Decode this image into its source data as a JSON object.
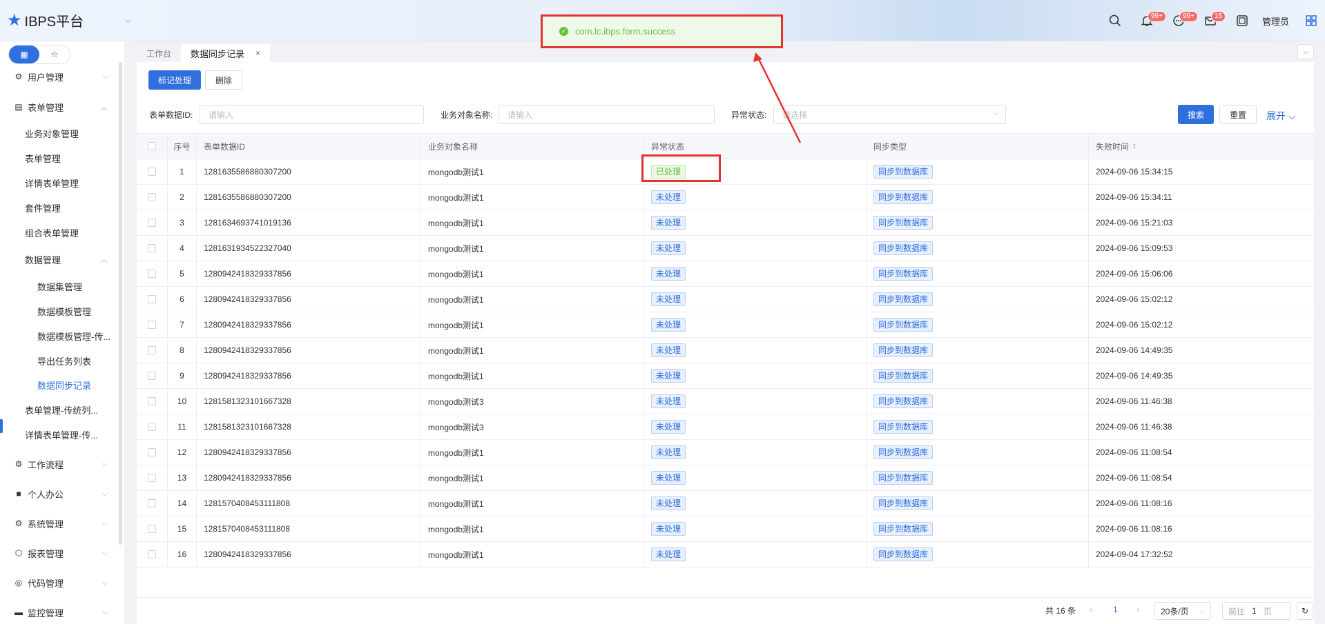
{
  "app": {
    "title": "IBPS平台",
    "user": "管理员"
  },
  "badges": {
    "bell": "99+",
    "message": "99+",
    "mail": "15"
  },
  "toast": {
    "message": "com.lc.ibps.form.success"
  },
  "sidebar": {
    "items": [
      {
        "label": "用户管理",
        "icon": "gear-icon",
        "level": 1
      },
      {
        "label": "表单管理",
        "icon": "form-icon",
        "level": 1
      },
      {
        "label": "业务对象管理",
        "level": 2
      },
      {
        "label": "表单管理",
        "level": 2
      },
      {
        "label": "详情表单管理",
        "level": 2
      },
      {
        "label": "套件管理",
        "level": 2
      },
      {
        "label": "组合表单管理",
        "level": 2
      },
      {
        "label": "数据管理",
        "level": 2
      },
      {
        "label": "数据集管理",
        "level": 3
      },
      {
        "label": "数据模板管理",
        "level": 3
      },
      {
        "label": "数据模板管理-传...",
        "level": 3
      },
      {
        "label": "导出任务列表",
        "level": 3
      },
      {
        "label": "数据同步记录",
        "level": 3,
        "active": true
      },
      {
        "label": "表单管理-传统列...",
        "level": 2
      },
      {
        "label": "详情表单管理-传...",
        "level": 2
      },
      {
        "label": "工作流程",
        "icon": "workflow-icon",
        "level": 1
      },
      {
        "label": "个人办公",
        "icon": "briefcase-icon",
        "level": 1
      },
      {
        "label": "系统管理",
        "icon": "gear-icon",
        "level": 1
      },
      {
        "label": "报表管理",
        "icon": "cube-icon",
        "level": 1
      },
      {
        "label": "代码管理",
        "icon": "code-icon",
        "level": 1
      },
      {
        "label": "监控管理",
        "icon": "monitor-icon",
        "level": 1
      }
    ]
  },
  "tabs": [
    {
      "label": "工作台"
    },
    {
      "label": "数据同步记录",
      "active": true
    }
  ],
  "toolbar": {
    "mark_label": "标记处理",
    "delete_label": "删除"
  },
  "filters": {
    "form_id_label": "表单数据ID:",
    "form_id_placeholder": "请输入",
    "biz_name_label": "业务对象名称:",
    "biz_name_placeholder": "请输入",
    "status_label": "异常状态:",
    "status_placeholder": "请选择",
    "search_label": "搜索",
    "reset_label": "重置",
    "expand_label": "展开"
  },
  "table": {
    "headers": [
      "序号",
      "表单数据ID",
      "业务对象名称",
      "异常状态",
      "同步类型",
      "失败时间"
    ],
    "rows": [
      {
        "no": "1",
        "id": "1281635586880307200",
        "name": "mongodb测试1",
        "status": "已处理",
        "type": "同步到数据库",
        "time": "2024-09-06 15:34:15"
      },
      {
        "no": "2",
        "id": "1281635586880307200",
        "name": "mongodb测试1",
        "status": "未处理",
        "type": "同步到数据库",
        "time": "2024-09-06 15:34:11"
      },
      {
        "no": "3",
        "id": "1281634693741019136",
        "name": "mongodb测试1",
        "status": "未处理",
        "type": "同步到数据库",
        "time": "2024-09-06 15:21:03"
      },
      {
        "no": "4",
        "id": "1281631934522327040",
        "name": "mongodb测试1",
        "status": "未处理",
        "type": "同步到数据库",
        "time": "2024-09-06 15:09:53"
      },
      {
        "no": "5",
        "id": "1280942418329337856",
        "name": "mongodb测试1",
        "status": "未处理",
        "type": "同步到数据库",
        "time": "2024-09-06 15:06:06"
      },
      {
        "no": "6",
        "id": "1280942418329337856",
        "name": "mongodb测试1",
        "status": "未处理",
        "type": "同步到数据库",
        "time": "2024-09-06 15:02:12"
      },
      {
        "no": "7",
        "id": "1280942418329337856",
        "name": "mongodb测试1",
        "status": "未处理",
        "type": "同步到数据库",
        "time": "2024-09-06 15:02:12"
      },
      {
        "no": "8",
        "id": "1280942418329337856",
        "name": "mongodb测试1",
        "status": "未处理",
        "type": "同步到数据库",
        "time": "2024-09-06 14:49:35"
      },
      {
        "no": "9",
        "id": "1280942418329337856",
        "name": "mongodb测试1",
        "status": "未处理",
        "type": "同步到数据库",
        "time": "2024-09-06 14:49:35"
      },
      {
        "no": "10",
        "id": "1281581323101667328",
        "name": "mongodb测试3",
        "status": "未处理",
        "type": "同步到数据库",
        "time": "2024-09-06 11:46:38"
      },
      {
        "no": "11",
        "id": "1281581323101667328",
        "name": "mongodb测试3",
        "status": "未处理",
        "type": "同步到数据库",
        "time": "2024-09-06 11:46:38"
      },
      {
        "no": "12",
        "id": "1280942418329337856",
        "name": "mongodb测试1",
        "status": "未处理",
        "type": "同步到数据库",
        "time": "2024-09-06 11:08:54"
      },
      {
        "no": "13",
        "id": "1280942418329337856",
        "name": "mongodb测试1",
        "status": "未处理",
        "type": "同步到数据库",
        "time": "2024-09-06 11:08:54"
      },
      {
        "no": "14",
        "id": "1281570408453111808",
        "name": "mongodb测试1",
        "status": "未处理",
        "type": "同步到数据库",
        "time": "2024-09-06 11:08:16"
      },
      {
        "no": "15",
        "id": "1281570408453111808",
        "name": "mongodb测试1",
        "status": "未处理",
        "type": "同步到数据库",
        "time": "2024-09-06 11:08:16"
      },
      {
        "no": "16",
        "id": "1280942418329337856",
        "name": "mongodb测试1",
        "status": "未处理",
        "type": "同步到数据库",
        "time": "2024-09-04 17:32:52"
      }
    ]
  },
  "pager": {
    "total": "共 16 条",
    "page": "1",
    "size": "20条/页",
    "goto_prefix": "前往",
    "goto_value": "1",
    "goto_suffix": "页"
  },
  "colors": {
    "primary": "#2f6fde",
    "success": "#67c23a",
    "annotation": "#e5322d"
  }
}
